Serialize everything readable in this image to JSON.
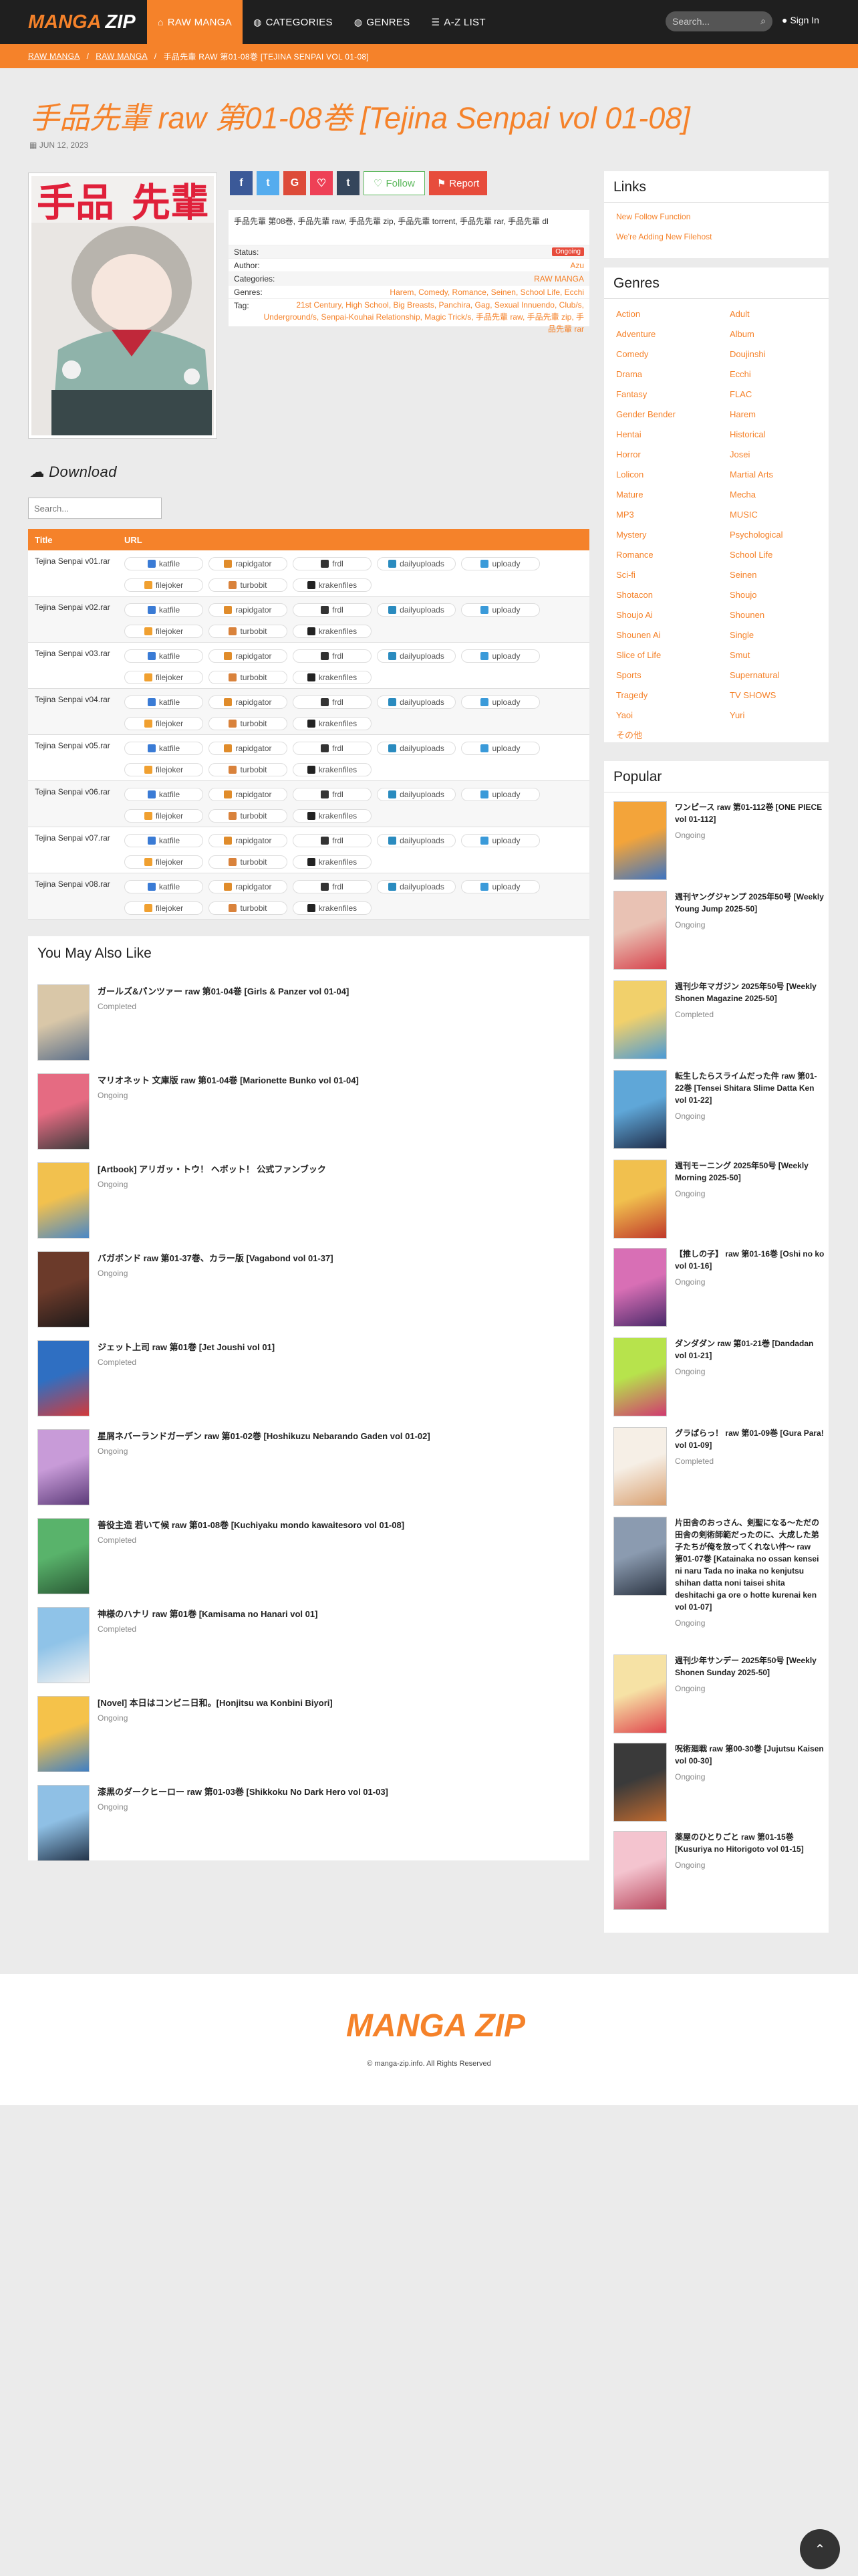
{
  "nav": {
    "logo_a": "MANGA",
    "logo_b": "ZIP",
    "items": [
      {
        "label": "RAW MANGA",
        "icon": "home-icon"
      },
      {
        "label": "CATEGORIES",
        "icon": "globe-icon"
      },
      {
        "label": "GENRES",
        "icon": "globe-icon"
      },
      {
        "label": "A-Z LIST",
        "icon": "list-icon"
      }
    ],
    "search_placeholder": "Search...",
    "signin": "Sign In"
  },
  "breadcrumb": {
    "items": [
      "RAW MANGA",
      "RAW MANGA"
    ],
    "current": "手品先輩 RAW 第01-08巻 [TEJINA SENPAI VOL 01-08]"
  },
  "page": {
    "title": "手品先輩 raw 第01-08巻 [Tejina Senpai vol 01-08]",
    "date": "JUN 12, 2023"
  },
  "share": {
    "follow": "Follow",
    "report": "Report",
    "colors": {
      "facebook": "#3b5998",
      "twitter": "#55acee",
      "google": "#dd4b39",
      "pocket": "#ee4056",
      "tumblr": "#35465c"
    }
  },
  "info": {
    "description": "手品先輩 第08巻, 手品先輩 raw, 手品先輩 zip, 手品先輩 torrent, 手品先輩 rar, 手品先輩 dl",
    "status_label": "Status:",
    "status": "Ongoing",
    "author_label": "Author:",
    "author": "Azu",
    "categories_label": "Categories:",
    "categories": "RAW MANGA",
    "genres_label": "Genres:",
    "genres": "Harem, Comedy, Romance, Seinen, School Life, Ecchi",
    "tag_label": "Tag:",
    "tags": "21st Century, High School, Big Breasts, Panchira, Gag, Sexual Innuendo, Club/s, Underground/s, Senpai-Kouhai Relationship, Magic Trick/s, 手品先輩 raw, 手品先輩 zip, 手品先輩 rar"
  },
  "download": {
    "heading": "Download",
    "search_placeholder": "Search...",
    "col_title": "Title",
    "col_url": "URL",
    "hosts": [
      {
        "name": "katfile",
        "color": "#3a7bd5"
      },
      {
        "name": "rapidgator",
        "color": "#e08c2b"
      },
      {
        "name": "frdl",
        "color": "#333333"
      },
      {
        "name": "dailyuploads",
        "color": "#2a8bbf"
      },
      {
        "name": "uploady",
        "color": "#3a9ad9"
      },
      {
        "name": "filejoker",
        "color": "#f0a030"
      },
      {
        "name": "turbobit",
        "color": "#d9823b"
      },
      {
        "name": "krakenfiles",
        "color": "#222222"
      }
    ],
    "rows": [
      "Tejina Senpai v01.rar",
      "Tejina Senpai v02.rar",
      "Tejina Senpai v03.rar",
      "Tejina Senpai v04.rar",
      "Tejina Senpai v05.rar",
      "Tejina Senpai v06.rar",
      "Tejina Senpai v07.rar",
      "Tejina Senpai v08.rar"
    ]
  },
  "also_like": {
    "heading": "You May Also Like",
    "items": [
      {
        "title": "ガールズ&パンツァー raw 第01-04巻 [Girls & Panzer vol 01-04]",
        "status": "Completed",
        "c1": "#d9c7a8",
        "c2": "#5b6f8a"
      },
      {
        "title": "マリオネット 文庫版 raw 第01-04巻 [Marionette Bunko vol 01-04]",
        "status": "Ongoing",
        "c1": "#e56b82",
        "c2": "#3b3b3b"
      },
      {
        "title": "[Artbook] アリガッ・トウ！ ヘボット！ 公式ファンブック",
        "status": "Ongoing",
        "c1": "#f2c14e",
        "c2": "#4a87c6"
      },
      {
        "title": "バガボンド raw 第01-37巻、カラー版 [Vagabond vol 01-37]",
        "status": "Ongoing",
        "c1": "#6b3a2a",
        "c2": "#1e1a1a"
      },
      {
        "title": "ジェット上司 raw 第01巻 [Jet Joushi vol 01]",
        "status": "Completed",
        "c1": "#2f6fc2",
        "c2": "#d33a3a"
      },
      {
        "title": "星屑ネバーランドガーデン raw 第01-02巻 [Hoshikuzu Nebarando Gaden vol 01-02]",
        "status": "Ongoing",
        "c1": "#c89bd8",
        "c2": "#5d3c7a"
      },
      {
        "title": "善役主造 若いて候 raw 第01-08巻 [Kuchiyaku mondo kawaitesoro vol 01-08]",
        "status": "Completed",
        "c1": "#59b36b",
        "c2": "#2a5a35"
      },
      {
        "title": "神様のハナリ raw 第01巻 [Kamisama no Hanari vol 01]",
        "status": "Completed",
        "c1": "#8fc3e8",
        "c2": "#f2f2f2"
      },
      {
        "title": "[Novel] 本日はコンビニ日和。[Honjitsu wa Konbini Biyori]",
        "status": "Ongoing",
        "c1": "#f5c24a",
        "c2": "#3f7fc4"
      },
      {
        "title": "漆黒のダークヒーロー raw 第01-03巻 [Shikkoku No Dark Hero vol 01-03]",
        "status": "Ongoing",
        "c1": "#8fc0e5",
        "c2": "#23344a"
      }
    ]
  },
  "sidebar": {
    "links_heading": "Links",
    "links": [
      "New Follow Function",
      "We're Adding New Filehost"
    ],
    "genres_heading": "Genres",
    "genres": [
      "Action",
      "Adult",
      "Adventure",
      "Album",
      "Comedy",
      "Doujinshi",
      "Drama",
      "Ecchi",
      "Fantasy",
      "FLAC",
      "Gender Bender",
      "Harem",
      "Hentai",
      "Historical",
      "Horror",
      "Josei",
      "Lolicon",
      "Martial Arts",
      "Mature",
      "Mecha",
      "MP3",
      "MUSIC",
      "Mystery",
      "Psychological",
      "Romance",
      "School Life",
      "Sci-fi",
      "Seinen",
      "Shotacon",
      "Shoujo",
      "Shoujo Ai",
      "Shounen",
      "Shounen Ai",
      "Single",
      "Slice of Life",
      "Smut",
      "Sports",
      "Supernatural",
      "Tragedy",
      "TV SHOWS",
      "Yaoi",
      "Yuri",
      "その他"
    ],
    "popular_heading": "Popular",
    "popular": [
      {
        "title": "ワンピース raw 第01-112巻 [ONE PIECE vol 01-112]",
        "status": "Ongoing",
        "c1": "#f3a43a",
        "c2": "#3d74c2"
      },
      {
        "title": "週刊ヤングジャンプ 2025年50号 [Weekly Young Jump 2025-50]",
        "status": "Ongoing",
        "c1": "#e9c2b4",
        "c2": "#d6414b"
      },
      {
        "title": "週刊少年マガジン 2025年50号 [Weekly Shonen Magazine 2025-50]",
        "status": "Completed",
        "c1": "#f1d06b",
        "c2": "#4b9ad6"
      },
      {
        "title": "転生したらスライムだった件 raw 第01-22巻 [Tensei Shitara Slime Datta Ken vol 01-22]",
        "status": "Ongoing",
        "c1": "#5fa7d8",
        "c2": "#1f2c48"
      },
      {
        "title": "週刊モーニング 2025年50号 [Weekly Morning 2025-50]",
        "status": "Ongoing",
        "c1": "#f1c04e",
        "c2": "#c0392b"
      },
      {
        "title": "【推しの子】 raw 第01-16巻 [Oshi no ko vol 01-16]",
        "status": "Ongoing",
        "c1": "#d86fb5",
        "c2": "#4a2a6a"
      },
      {
        "title": "ダンダダン raw 第01-21巻 [Dandadan vol 01-21]",
        "status": "Ongoing",
        "c1": "#b7e34c",
        "c2": "#d03a6f"
      },
      {
        "title": "グラぱらっ！ raw 第01-09巻 [Gura Para! vol 01-09]",
        "status": "Completed",
        "c1": "#f6efe6",
        "c2": "#d9a070"
      },
      {
        "title": "片田舎のおっさん、剣聖になる～ただの田舎の剣術師範だったのに、大成した弟子たちが俺を放ってくれない件～ raw 第01-07巻 [Katainaka no ossan kensei ni naru Tada no inaka no kenjutsu shihan datta noni taisei shita deshitachi ga ore o hotte kurenai ken vol 01-07]",
        "status": "Ongoing",
        "c1": "#8b9bb0",
        "c2": "#2b3442"
      },
      {
        "title": "週刊少年サンデー 2025年50号 [Weekly Shonen Sunday 2025-50]",
        "status": "Ongoing",
        "c1": "#f6e2a5",
        "c2": "#e0454d"
      },
      {
        "title": "呪術廻戦 raw 第00-30巻 [Jujutsu Kaisen vol 00-30]",
        "status": "Ongoing",
        "c1": "#3a3a3a",
        "c2": "#c26b2f"
      },
      {
        "title": "薬屋のひとりごと raw 第01-15巻 [Kusuriya no Hitorigoto vol 01-15]",
        "status": "Ongoing",
        "c1": "#f4c4cf",
        "c2": "#b9485e"
      }
    ]
  },
  "footer": {
    "logo_a": "MANGA",
    "logo_b": "ZIP",
    "copyright": "© manga-zip.info. All Rights Reserved"
  }
}
